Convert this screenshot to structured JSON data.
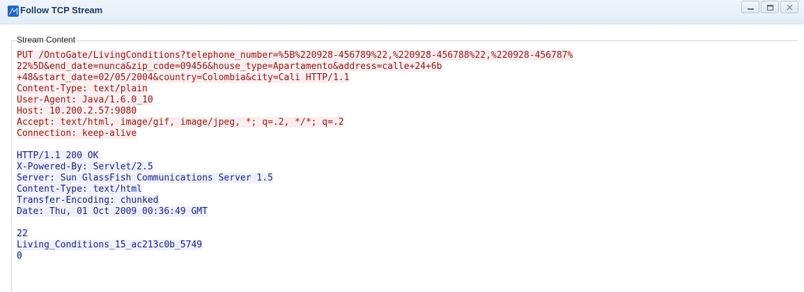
{
  "window": {
    "title": "Follow TCP Stream",
    "icon": "wireshark-fin-icon",
    "accent": "#1e395b"
  },
  "stream": {
    "group_label": "Stream Content",
    "request_color": "#8b1a1a",
    "request_bg": "#fbeded",
    "response_color": "#1a237e",
    "response_bg": "#eef1fb",
    "request_lines": [
      "PUT /OntoGate/LivingConditions?telephone_number=%5B%220928-456789%22,%220928-456788%22,%220928-456787%",
      "22%5D&end_date=nunca&zip_code=09456&house_type=Apartamento&address=calle+24+6b",
      "+48&start_date=02/05/2004&country=Colombia&city=Cali HTTP/1.1",
      "Content-Type: text/plain",
      "User-Agent: Java/1.6.0_10",
      "Host: 10.200.2.57:9080",
      "Accept: text/html, image/gif, image/jpeg, *; q=.2, */*; q=.2",
      "Connection: keep-alive"
    ],
    "response_lines": [
      "HTTP/1.1 200 OK",
      "X-Powered-By: Servlet/2.5",
      "Server: Sun GlassFish Communications Server 1.5",
      "Content-Type: text/html",
      "Transfer-Encoding: chunked",
      "Date: Thu, 01 Oct 2009 00:36:49 GMT"
    ],
    "body_lines": [
      "22",
      "Living_Conditions_15_ac213c0b_5749",
      "0"
    ]
  }
}
